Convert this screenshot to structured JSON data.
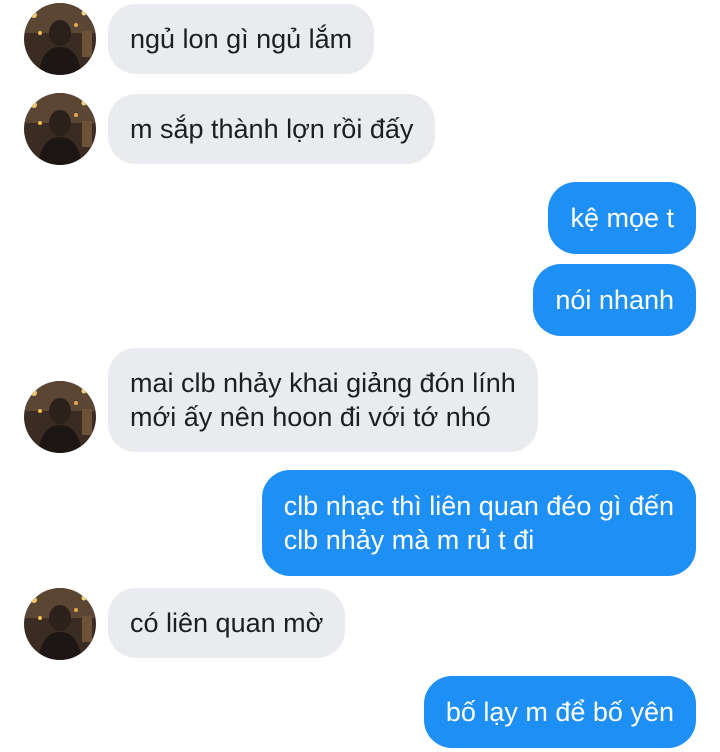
{
  "conversation": {
    "messages": [
      {
        "direction": "incoming",
        "lines": [
          "ngủ lon gì ngủ lắm"
        ]
      },
      {
        "direction": "incoming",
        "lines": [
          "m sắp thành lợn rồi đấy"
        ]
      },
      {
        "direction": "outgoing",
        "lines": [
          "kệ mọe t"
        ]
      },
      {
        "direction": "outgoing",
        "lines": [
          "nói nhanh"
        ]
      },
      {
        "direction": "incoming",
        "lines": [
          "mai clb nhảy khai giảng đón lính",
          "mới ấy nên hoon đi với tớ nhó"
        ]
      },
      {
        "direction": "outgoing",
        "lines": [
          "clb nhạc thì liên quan đéo gì đến",
          "clb nhảy mà m rủ t đi"
        ]
      },
      {
        "direction": "incoming",
        "lines": [
          "có liên quan mờ"
        ]
      },
      {
        "direction": "outgoing",
        "lines": [
          "bố lạy m để bố yên"
        ]
      }
    ]
  },
  "colors": {
    "incoming_bubble": "#e9ebee",
    "outgoing_bubble": "#1e8ff5"
  },
  "icons": {
    "avatar": "contact-avatar-photo"
  }
}
